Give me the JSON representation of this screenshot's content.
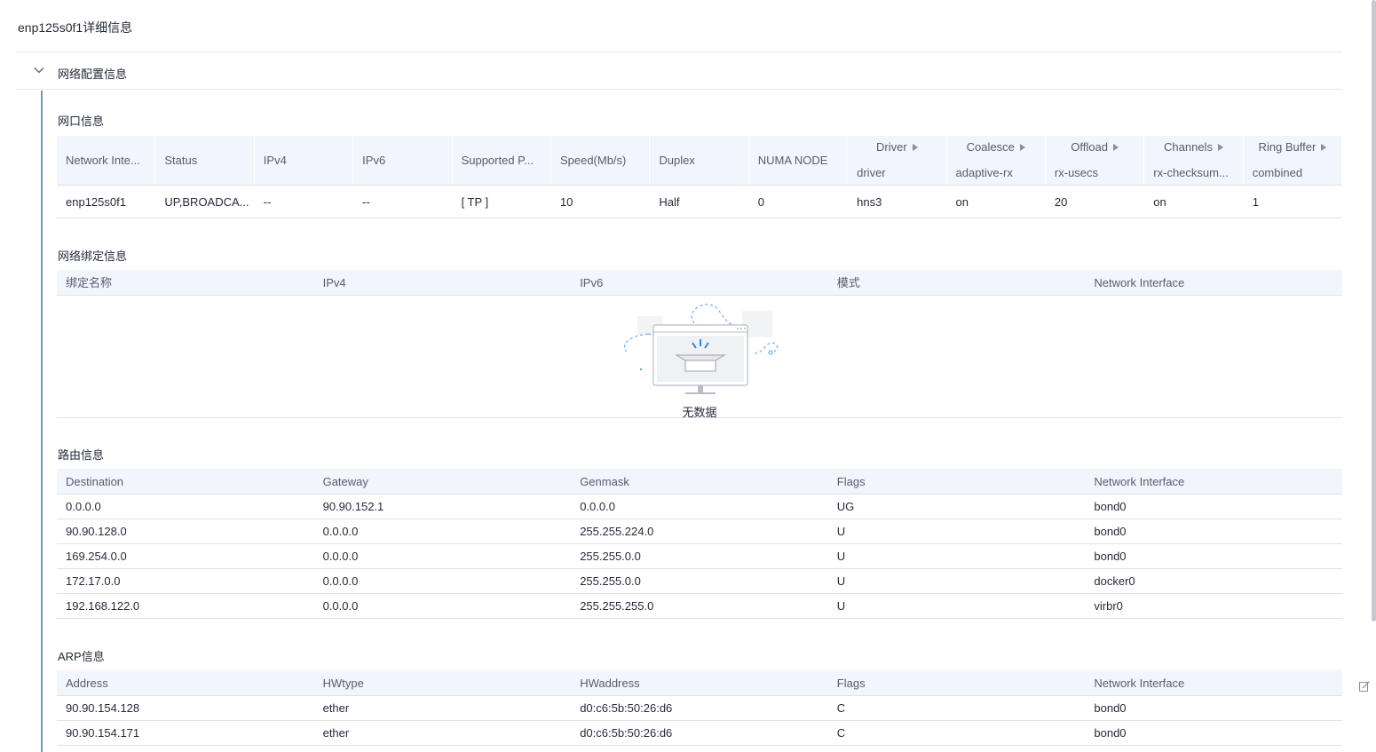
{
  "page_title": "enp125s0f1详细信息",
  "collapse_label": "网络配置信息",
  "sections": {
    "nic_title": "网口信息",
    "bond_title": "网络绑定信息",
    "route_title": "路由信息",
    "arp_title": "ARP信息"
  },
  "nic_table": {
    "headers": [
      "Network Inte...",
      "Status",
      "IPv4",
      "IPv6",
      "Supported P...",
      "Speed(Mb/s)",
      "Duplex",
      "NUMA NODE"
    ],
    "nested_headers": [
      {
        "top": "Driver",
        "bottom": "driver"
      },
      {
        "top": "Coalesce",
        "bottom": "adaptive-rx"
      },
      {
        "top": "Offload",
        "bottom": "rx-usecs"
      },
      {
        "top": "Channels",
        "bottom": "rx-checksum..."
      },
      {
        "top": "Ring Buffer",
        "bottom": "combined"
      }
    ],
    "row": [
      "enp125s0f1",
      "UP,BROADCA...",
      "--",
      "--",
      "[ TP ]",
      "10",
      "Half",
      "0",
      "hns3",
      "on",
      "20",
      "on",
      "1"
    ]
  },
  "bond_table": {
    "headers": [
      "绑定名称",
      "IPv4",
      "IPv6",
      "模式",
      "Network Interface"
    ],
    "empty_text": "无数据"
  },
  "route_table": {
    "headers": [
      "Destination",
      "Gateway",
      "Genmask",
      "Flags",
      "Network Interface"
    ],
    "rows": [
      [
        "0.0.0.0",
        "90.90.152.1",
        "0.0.0.0",
        "UG",
        "bond0"
      ],
      [
        "90.90.128.0",
        "0.0.0.0",
        "255.255.224.0",
        "U",
        "bond0"
      ],
      [
        "169.254.0.0",
        "0.0.0.0",
        "255.255.0.0",
        "U",
        "bond0"
      ],
      [
        "172.17.0.0",
        "0.0.0.0",
        "255.255.0.0",
        "U",
        "docker0"
      ],
      [
        "192.168.122.0",
        "0.0.0.0",
        "255.255.255.0",
        "U",
        "virbr0"
      ]
    ]
  },
  "arp_table": {
    "headers": [
      "Address",
      "HWtype",
      "HWaddress",
      "Flags",
      "Network Interface"
    ],
    "rows": [
      [
        "90.90.154.128",
        "ether",
        "d0:c6:5b:50:26:d6",
        "C",
        "bond0"
      ],
      [
        "90.90.154.171",
        "ether",
        "d0:c6:5b:50:26:d6",
        "C",
        "bond0"
      ]
    ]
  },
  "icons": {
    "collapse": "chevron-down-icon",
    "empty": "empty-box-icon",
    "edit": "edit-icon",
    "sort_arrow": "caret-right-icon"
  },
  "colors": {
    "accent_bar": "#6f9ab2",
    "header_bg": "#f2f5fc",
    "border": "#dfe1e6"
  }
}
